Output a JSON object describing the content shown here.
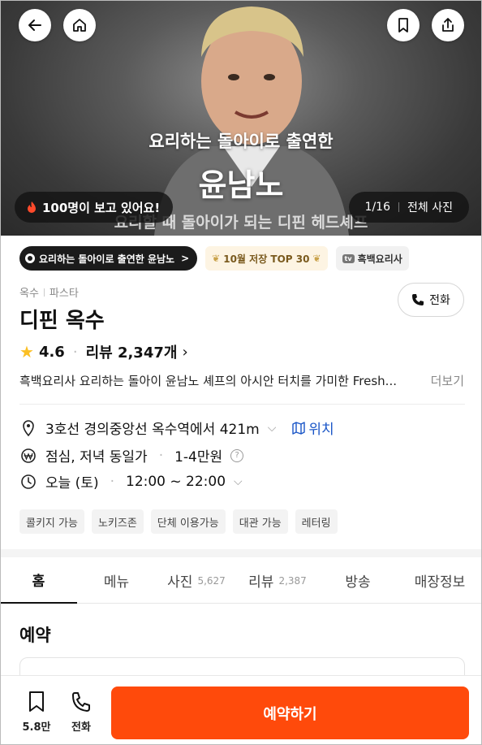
{
  "hero": {
    "caption_line1": "요리하는 돌아이로 출연한",
    "caption_line2": "윤남노",
    "caption_line3": "요리할 때 돌아이가 되는 디핀 헤드셰프",
    "viewers_label": "100명이 보고 있어요!",
    "photo_counter": "1/16",
    "all_photos_label": "전체 사진"
  },
  "tags": [
    {
      "label": "요리하는 돌아이로 출연한 윤남노",
      "icon": "logo-icon",
      "chevron": ">"
    },
    {
      "label": "10월 저장 TOP 30",
      "icon": "laurel-icon"
    },
    {
      "label": "흑백요리사",
      "icon": "tv-icon",
      "icon_text": "tv"
    }
  ],
  "restaurant": {
    "area": "옥수",
    "category": "파스타",
    "name": "디핀 옥수",
    "rating": "4.6",
    "review_label": "리뷰 2,347개",
    "description": "흑백요리사 요리하는 돌아이 윤남노 셰프의 아시안 터치를 가미한 Fresh...",
    "more_label": "더보기",
    "call_label": "전화"
  },
  "info": {
    "location": "3호선 경의중앙선 옥수역에서 421m",
    "location_link": "위치",
    "meal": "점심, 저녁 동일가",
    "price": "1-4만원",
    "hours_day": "오늘 (토)",
    "hours_time": "12:00 ~ 22:00"
  },
  "amenities": [
    "콜키지 가능",
    "노키즈존",
    "단체 이용가능",
    "대관 가능",
    "레터링"
  ],
  "tabs": [
    {
      "label": "홈",
      "count": ""
    },
    {
      "label": "메뉴",
      "count": ""
    },
    {
      "label": "사진",
      "count": "5,627"
    },
    {
      "label": "리뷰",
      "count": "2,387"
    },
    {
      "label": "방송",
      "count": ""
    },
    {
      "label": "매장정보",
      "count": ""
    }
  ],
  "section": {
    "title": "예약"
  },
  "bottom": {
    "save_count": "5.8만",
    "call_label": "전화",
    "reserve_label": "예약하기"
  },
  "colors": {
    "accent": "#ff4a0b",
    "link": "#1a56c7",
    "star": "#fbbf24"
  }
}
